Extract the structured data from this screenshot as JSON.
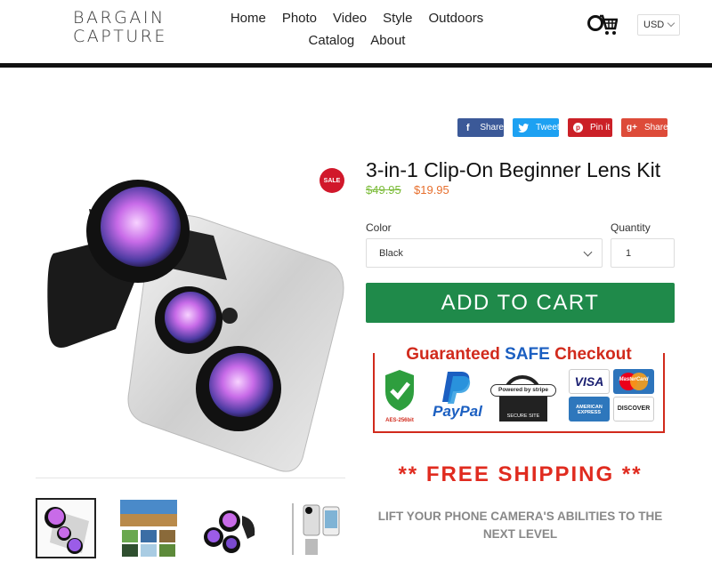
{
  "header": {
    "logo_line1": "BARGAIN",
    "logo_line2": "CAPTURE",
    "nav_row1": [
      "Home",
      "Photo",
      "Video",
      "Style",
      "Outdoors"
    ],
    "nav_row2": [
      "Catalog",
      "About"
    ],
    "currency": "USD"
  },
  "share": {
    "facebook": "Share",
    "twitter": "Tweet",
    "pinterest": "Pin it",
    "googleplus": "Share"
  },
  "product": {
    "sale_badge": "SALE",
    "title": "3-in-1 Clip-On Beginner Lens Kit",
    "old_price": "$49.95",
    "new_price": "$19.95",
    "color_label": "Color",
    "color_value": "Black",
    "quantity_label": "Quantity",
    "quantity_value": "1",
    "add_to_cart": "ADD TO CART",
    "free_shipping": "** FREE SHIPPING **",
    "description": "LIFT YOUR PHONE CAMERA'S ABILITIES TO THE NEXT LEVEL"
  },
  "guarantee": {
    "title_part1": "Guaranteed ",
    "title_safe": "SAFE",
    "title_part2": " Checkout",
    "aes": "AES-256bit",
    "paypal": "PayPal",
    "stripe_top": "Powered by stripe",
    "stripe_bottom": "SECURE SITE",
    "visa": "VISA",
    "mastercard": "MasterCard",
    "amex": "AMERICAN EXPRESS",
    "discover": "DISCOVER"
  },
  "colors": {
    "accent_green": "#1f8a4a",
    "sale_red": "#d1182b",
    "old_price": "#7cbc3a",
    "new_price": "#e76f2d",
    "facebook": "#3b5998",
    "twitter": "#1da1f2",
    "pinterest": "#cb2027",
    "googleplus": "#dd4b39"
  }
}
